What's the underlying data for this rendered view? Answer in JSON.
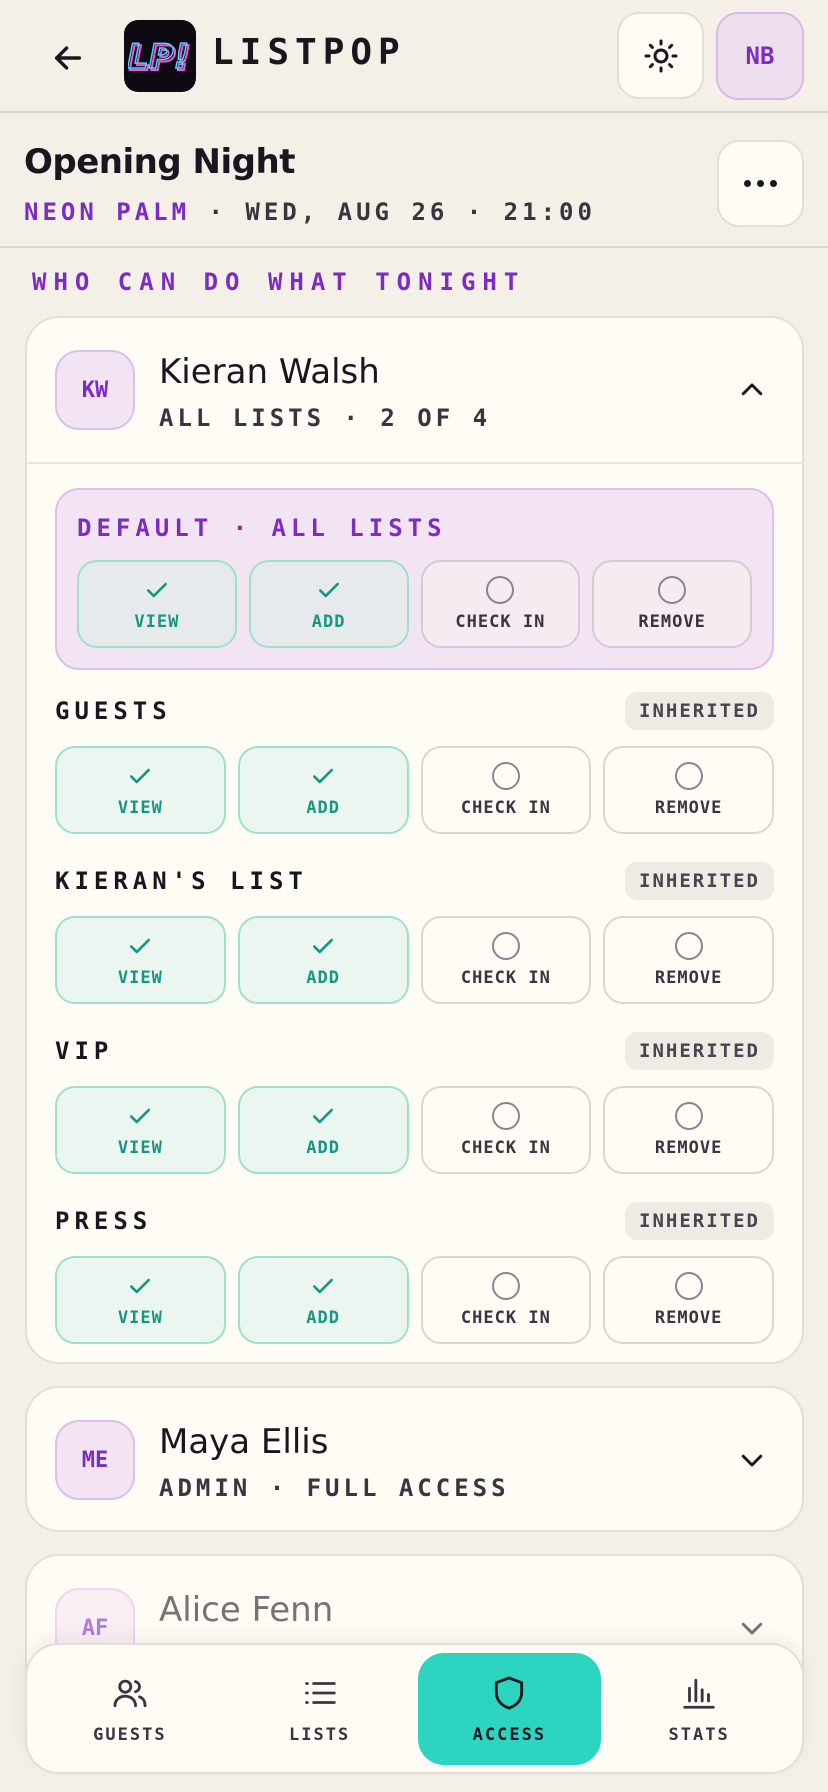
{
  "app": {
    "brand": "LISTPOP",
    "logo_text": "LP!",
    "user_initials": "NB"
  },
  "event": {
    "title": "Opening Night",
    "venue": "NEON PALM",
    "meta": " · WED, AUG 26 · 21:00"
  },
  "section_label": "WHO CAN DO WHAT TONIGHT",
  "permission_labels": {
    "view": "VIEW",
    "add": "ADD",
    "checkin": "CHECK IN",
    "remove": "REMOVE"
  },
  "default_label": "DEFAULT · ALL LISTS",
  "inherited_label": "INHERITED",
  "members": [
    {
      "initials": "KW",
      "name": "Kieran Walsh",
      "sub": "ALL LISTS · 2 OF 4",
      "expanded": true
    },
    {
      "initials": "ME",
      "name": "Maya Ellis",
      "sub": "ADMIN · FULL ACCESS",
      "expanded": false
    },
    {
      "initials": "AF",
      "name": "Alice Fenn",
      "sub": "",
      "expanded": false
    }
  ],
  "lists": [
    {
      "name": "GUESTS",
      "view": true,
      "add": true,
      "checkin": false,
      "remove": false
    },
    {
      "name": "KIERAN'S LIST",
      "view": true,
      "add": true,
      "checkin": false,
      "remove": false
    },
    {
      "name": "VIP",
      "view": true,
      "add": true,
      "checkin": false,
      "remove": false
    },
    {
      "name": "PRESS",
      "view": true,
      "add": true,
      "checkin": false,
      "remove": false
    }
  ],
  "nav": [
    {
      "label": "GUESTS",
      "icon": "users-icon"
    },
    {
      "label": "LISTS",
      "icon": "list-icon"
    },
    {
      "label": "ACCESS",
      "icon": "shield-icon",
      "active": true
    },
    {
      "label": "STATS",
      "icon": "bar-chart-icon"
    }
  ],
  "colors": {
    "accent_purple": "#7a2cc4",
    "accent_teal": "#2dd4bf",
    "background": "#f4f0e8"
  }
}
